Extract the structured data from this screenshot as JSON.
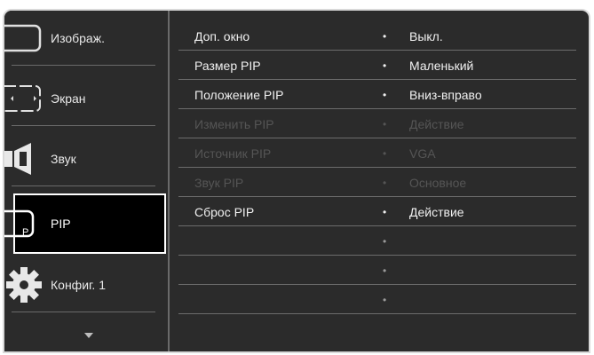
{
  "sidebar": {
    "items": [
      {
        "label": "Изображ.",
        "icon": "picture-icon"
      },
      {
        "label": "Экран",
        "icon": "screen-icon"
      },
      {
        "label": "Звук",
        "icon": "speaker-icon"
      },
      {
        "label": "PIP",
        "icon": "pip-icon",
        "icon_letter": "P",
        "selected": true
      },
      {
        "label": "Конфиг. 1",
        "icon": "gear-icon"
      }
    ],
    "more_icon": "chevron-down-icon"
  },
  "main": {
    "bullet": "•",
    "rows": [
      {
        "name": "Доп. окно",
        "value": "Выкл.",
        "state": "active"
      },
      {
        "name": "Размер PIP",
        "value": "Маленький",
        "state": "active"
      },
      {
        "name": "Положение PIP",
        "value": "Вниз-вправо",
        "state": "active"
      },
      {
        "name": "Изменить PIP",
        "value": "Действие",
        "state": "disabled"
      },
      {
        "name": "Источник PIP",
        "value": "VGA",
        "state": "disabled"
      },
      {
        "name": "Звук PIP",
        "value": "Основное",
        "state": "disabled"
      },
      {
        "name": "Сброс PIP",
        "value": "Действие",
        "state": "active"
      },
      {
        "name": "",
        "value": "",
        "state": "empty"
      },
      {
        "name": "",
        "value": "",
        "state": "empty"
      },
      {
        "name": "",
        "value": "",
        "state": "empty"
      }
    ]
  },
  "colors": {
    "background": "#2b2b2b",
    "text_active": "#f0f0f0",
    "text_disabled": "#555555",
    "selected_bg": "#000000",
    "selected_border": "#ffffff"
  }
}
